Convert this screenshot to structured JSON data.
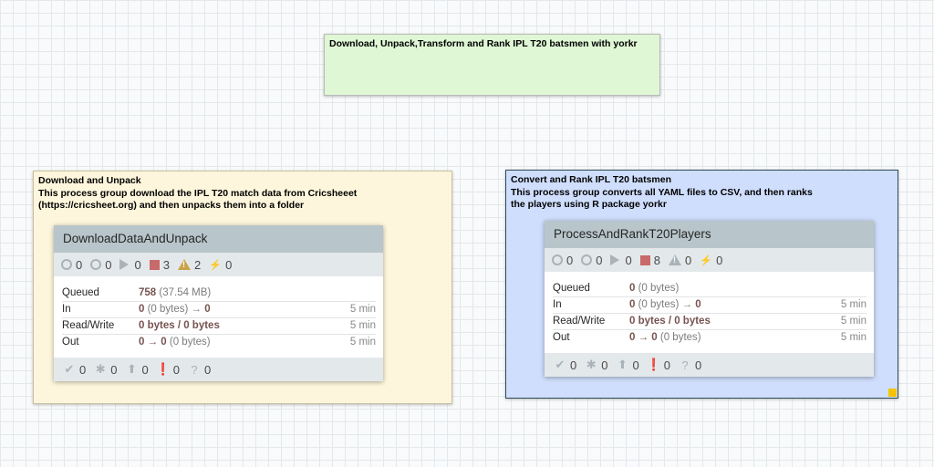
{
  "labels": {
    "title": "Download, Unpack,Transform and Rank IPL T20 batsmen with yorkr",
    "download": [
      "Download and Unpack",
      "This process group download the IPL T20 match data from Cricsheeet",
      "(https://cricsheet.org) and then unpacks them into a folder"
    ],
    "convert": [
      "Convert and Rank IPL T20 batsmen",
      "This process group converts all YAML files to CSV, and then ranks",
      "the players using R  package yorkr"
    ]
  },
  "groups": [
    {
      "name": "DownloadDataAndUnpack",
      "stats": {
        "transmitting": "0",
        "not_transmitting": "0",
        "running": "0",
        "stopped": "3",
        "invalid": "2",
        "disabled": "0"
      },
      "rows": [
        {
          "label": "Queued",
          "main": "758",
          "sub": " (37.54 MB)",
          "time": ""
        },
        {
          "label": "In",
          "main": "0",
          "sub": " (0 bytes) → ",
          "main2": "0",
          "time": "5 min"
        },
        {
          "label": "Read/Write",
          "main": "0 bytes / 0 bytes",
          "sub": "",
          "time": "5 min"
        },
        {
          "label": "Out",
          "main": "0 → 0",
          "sub": " (0 bytes)",
          "time": "5 min"
        }
      ],
      "footer": {
        "up_to_date": "0",
        "locally_modified": "0",
        "stale": "0",
        "sync_failure": "0",
        "unknown": "0"
      }
    },
    {
      "name": "ProcessAndRankT20Players",
      "stats": {
        "transmitting": "0",
        "not_transmitting": "0",
        "running": "0",
        "stopped": "8",
        "invalid": "0",
        "disabled": "0"
      },
      "rows": [
        {
          "label": "Queued",
          "main": "0",
          "sub": " (0 bytes)",
          "time": ""
        },
        {
          "label": "In",
          "main": "0",
          "sub": " (0 bytes) → ",
          "main2": "0",
          "time": "5 min"
        },
        {
          "label": "Read/Write",
          "main": "0 bytes / 0 bytes",
          "sub": "",
          "time": "5 min"
        },
        {
          "label": "Out",
          "main": "0 → 0",
          "sub": " (0 bytes)",
          "time": "5 min"
        }
      ],
      "footer": {
        "up_to_date": "0",
        "locally_modified": "0",
        "stale": "0",
        "sync_failure": "0",
        "unknown": "0"
      }
    }
  ],
  "colors": {
    "stopped": "#c96a6a",
    "invalid": "#c9a34a",
    "icon": "#aab3b8",
    "selection_handle": "#f5c400"
  }
}
